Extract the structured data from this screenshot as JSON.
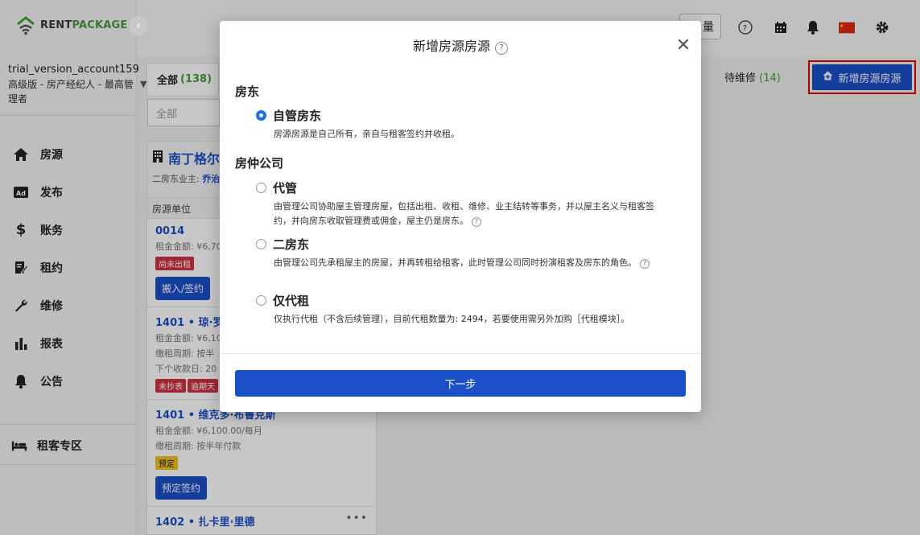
{
  "brand": {
    "name_left": "RENT",
    "name_right": "PACKAGE",
    "accent": "#4a9a3c",
    "primary": "#1c50c8"
  },
  "account": {
    "name": "trial_version_account159",
    "role": "高级版 - 房产经纪人 - 最高管理者"
  },
  "nav": [
    {
      "label": "房源",
      "icon": "home-icon"
    },
    {
      "label": "发布",
      "icon": "ad-icon"
    },
    {
      "label": "账务",
      "icon": "dollar-icon"
    },
    {
      "label": "租约",
      "icon": "contract-icon"
    },
    {
      "label": "维修",
      "icon": "wrench-icon"
    },
    {
      "label": "报表",
      "icon": "bar-chart-icon"
    },
    {
      "label": "公告",
      "icon": "bell-icon"
    }
  ],
  "tenant_area": {
    "label": "租客专区"
  },
  "topbar": {
    "button_label": "量"
  },
  "tabs": {
    "all_label": "全部",
    "all_count": "(138)",
    "repair_label": "待维修",
    "repair_count": "(14)"
  },
  "add_button": {
    "label": "新增房源房源"
  },
  "filter": {
    "placeholder": "全部"
  },
  "property": {
    "title": "南丁格尔",
    "owner_label": "二房东业主:",
    "owner_value": "乔治",
    "column_header": "房源单位"
  },
  "units": [
    {
      "title": "0014",
      "lines": [
        "租金金额: ¥6,70"
      ],
      "badges": [
        {
          "text": "尚未出租",
          "color": "red"
        }
      ],
      "button": "搬入/签约"
    },
    {
      "title": "1401 • 琼·罗杰",
      "lines": [
        "租金金额: ¥6,10",
        "缴租周期: 按半",
        "下个收款日: 20"
      ],
      "badges": [
        {
          "text": "未抄表",
          "color": "red"
        },
        {
          "text": "逾期天",
          "color": "red"
        }
      ],
      "button": ""
    },
    {
      "title": "1401 • 维克多·布鲁克斯",
      "lines": [
        "租金金额: ¥6,100.00/每月",
        "缴租周期: 按半年付款"
      ],
      "badges": [
        {
          "text": "预定",
          "color": "yellow"
        }
      ],
      "button": "预定签约"
    },
    {
      "title": "1402 • 扎卡里·里德",
      "lines": [],
      "badges": [],
      "button": ""
    }
  ],
  "modal": {
    "title": "新增房源房源",
    "group_landlord": "房东",
    "group_agency": "房仲公司",
    "options": [
      {
        "label": "自管房东",
        "desc": "房源房源是自己所有，亲自与租客签约并收租。",
        "checked": true
      },
      {
        "label": "代管",
        "desc": "由管理公司协助屋主管理房屋，包括出租、收租、维修、业主结转等事务，并以屋主名义与租客签约，并向房东收取管理费或佣金，屋主仍是房东。",
        "checked": false
      },
      {
        "label": "二房东",
        "desc": "由管理公司先承租屋主的房屋，并再转租给租客，此时管理公司同时扮演租客及房东的角色。",
        "checked": false
      },
      {
        "label": "仅代租",
        "desc": "仅执行代租（不含后续管理），目前代租数量为: 2494，若要使用需另外加购［代租模块］。",
        "checked": false
      }
    ],
    "next_label": "下一步"
  }
}
